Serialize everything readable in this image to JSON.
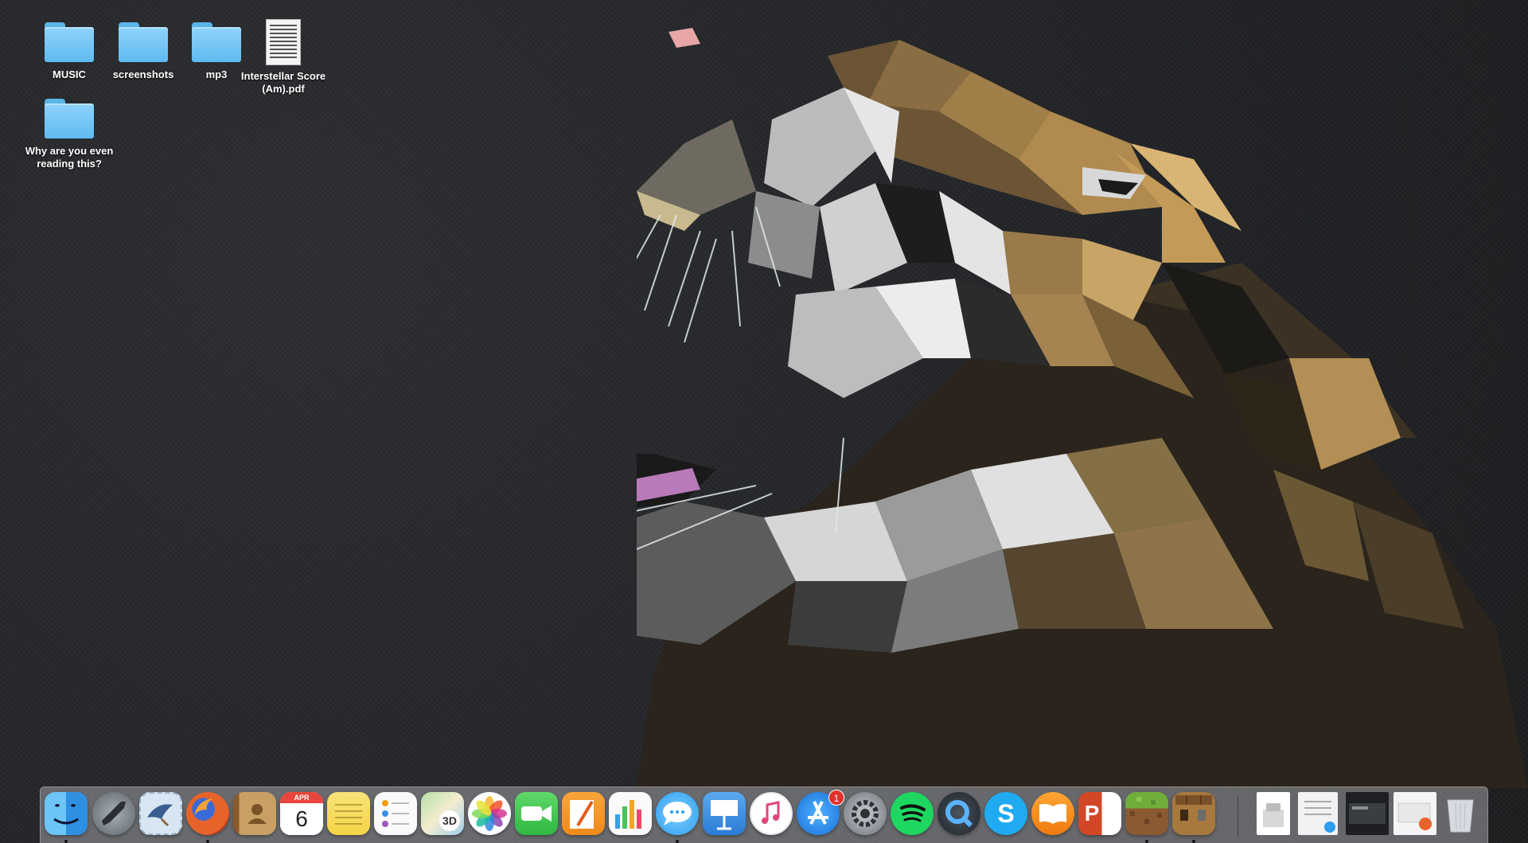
{
  "desktop": {
    "icons": [
      {
        "label": "MUSIC",
        "type": "folder"
      },
      {
        "label": "screenshots",
        "type": "folder"
      },
      {
        "label": "mp3",
        "type": "folder"
      },
      {
        "label": "Interstellar Score (Am).pdf",
        "type": "pdf"
      },
      {
        "label": "Why are you even reading this?",
        "type": "folder"
      }
    ]
  },
  "wallpaper": {
    "subject": "low-poly-roaring-tiger",
    "colors": {
      "background": "#202225",
      "fur_gold": "#b08a4e",
      "fur_dark": "#2a241c",
      "fur_light": "#d9d9d9"
    }
  },
  "dock": {
    "apps": [
      {
        "name": "Finder",
        "icon": "finder-icon",
        "running": true
      },
      {
        "name": "Launchpad",
        "icon": "rocket-icon",
        "running": false
      },
      {
        "name": "Mail",
        "icon": "mail-stamp-icon",
        "running": false
      },
      {
        "name": "Firefox",
        "icon": "firefox-icon",
        "running": true
      },
      {
        "name": "Contacts",
        "icon": "contacts-book-icon",
        "running": false
      },
      {
        "name": "Calendar",
        "icon": "calendar-icon",
        "running": false,
        "month": "APR",
        "day": "6"
      },
      {
        "name": "Notes",
        "icon": "notes-icon",
        "running": false
      },
      {
        "name": "Reminders",
        "icon": "reminders-icon",
        "running": false
      },
      {
        "name": "Maps",
        "icon": "maps-icon",
        "running": false,
        "text": "3D"
      },
      {
        "name": "Photos",
        "icon": "photos-icon",
        "running": false
      },
      {
        "name": "FaceTime",
        "icon": "facetime-icon",
        "running": false
      },
      {
        "name": "Pages",
        "icon": "pages-icon",
        "running": false
      },
      {
        "name": "Numbers",
        "icon": "numbers-chart-icon",
        "running": false
      },
      {
        "name": "Messages",
        "icon": "messages-bubble-icon",
        "running": true
      },
      {
        "name": "Keynote",
        "icon": "keynote-podium-icon",
        "running": false
      },
      {
        "name": "iTunes",
        "icon": "itunes-note-icon",
        "running": false
      },
      {
        "name": "App Store",
        "icon": "app-store-icon",
        "running": false,
        "badge": "1"
      },
      {
        "name": "System Preferences",
        "icon": "gear-icon",
        "running": false
      },
      {
        "name": "Spotify",
        "icon": "spotify-icon",
        "running": false
      },
      {
        "name": "QuickTime Player",
        "icon": "quicktime-icon",
        "running": false
      },
      {
        "name": "Skype",
        "icon": "skype-icon",
        "running": false,
        "text": "S"
      },
      {
        "name": "iBooks",
        "icon": "ibooks-icon",
        "running": false
      },
      {
        "name": "PowerPoint",
        "icon": "powerpoint-icon",
        "running": false,
        "text": "P"
      },
      {
        "name": "Minecraft",
        "icon": "grass-block-icon",
        "running": true
      },
      {
        "name": "Minecraft Crafting",
        "icon": "crafting-table-icon",
        "running": true
      }
    ],
    "stacks": [
      {
        "name": "Document",
        "icon": "document-stack-icon"
      },
      {
        "name": "Screenshot file",
        "icon": "file-preview-icon"
      },
      {
        "name": "Screen window",
        "icon": "window-thumbnail-icon"
      },
      {
        "name": "Downloads",
        "icon": "downloads-stack-icon"
      },
      {
        "name": "Trash",
        "icon": "trash-icon"
      }
    ]
  }
}
